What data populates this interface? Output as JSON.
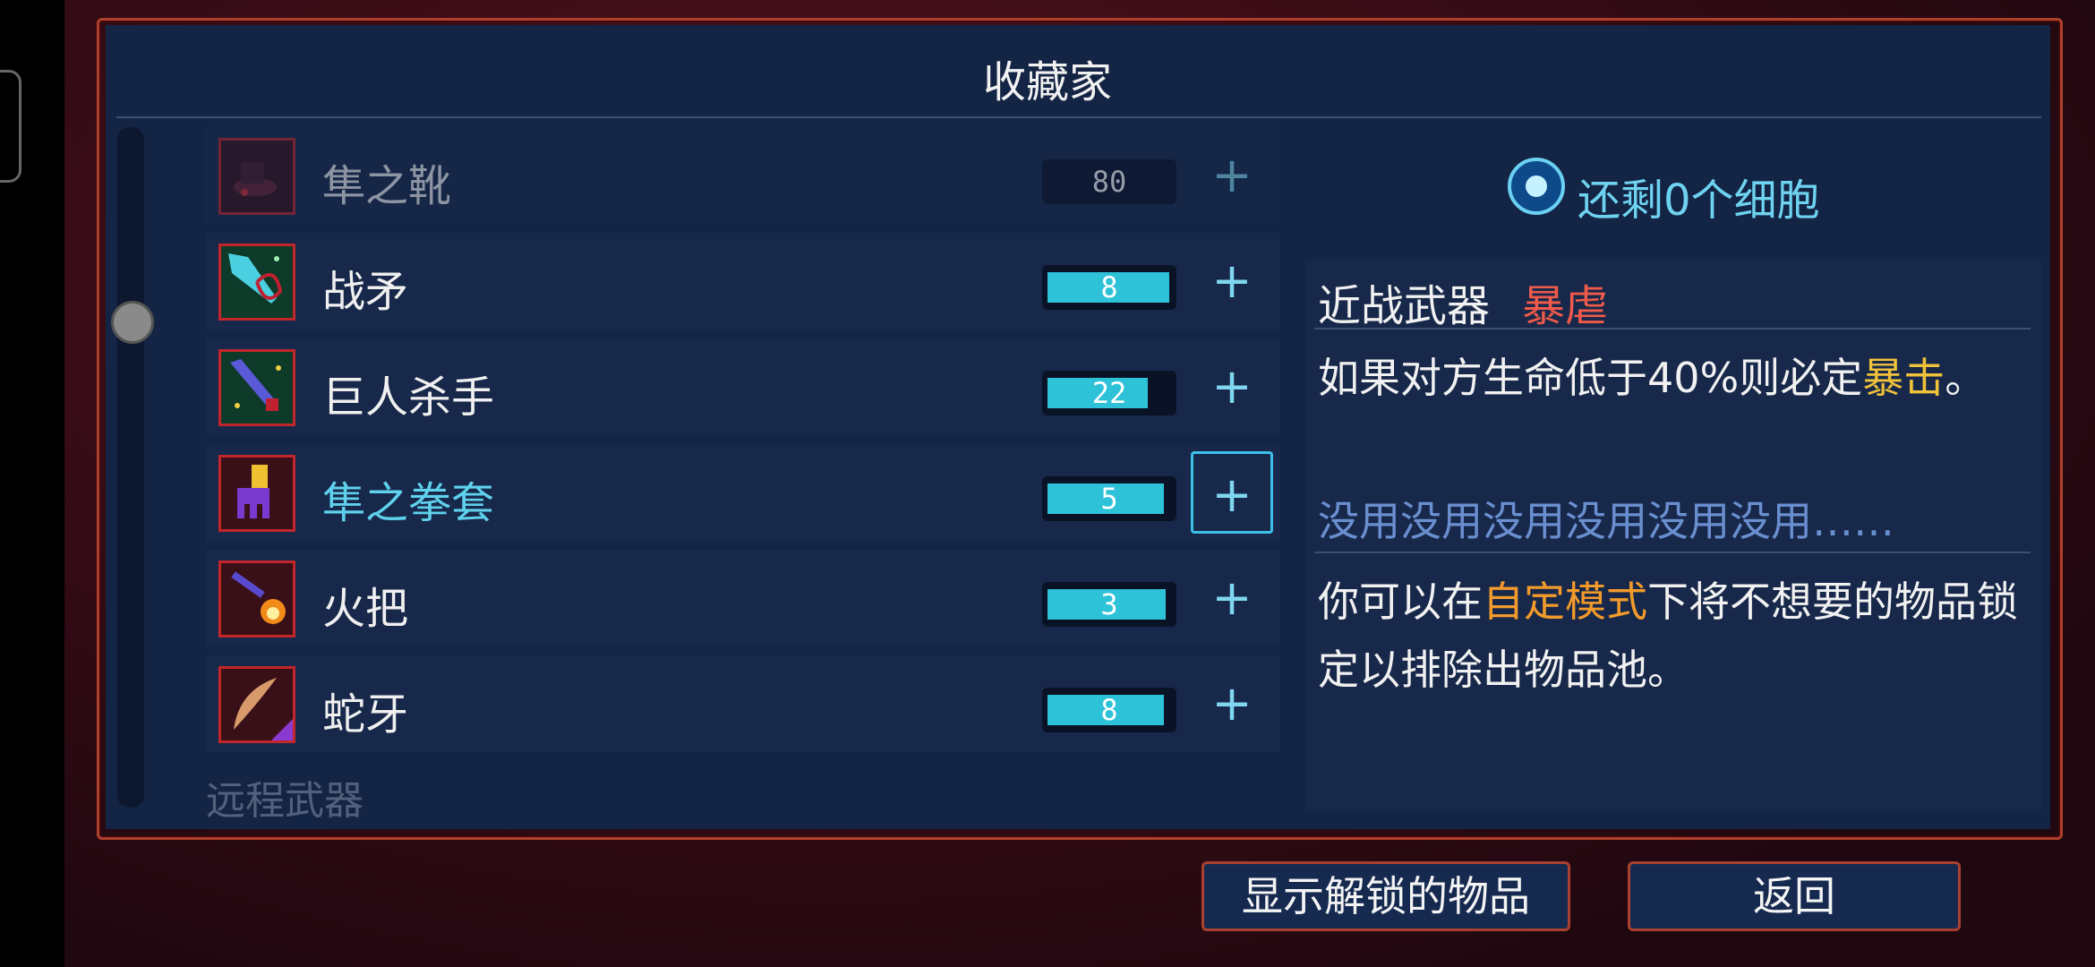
{
  "title": "收藏家",
  "cells": {
    "text": "还剩0个细胞"
  },
  "section_next": "远程武器",
  "items": [
    {
      "name": "隼之靴",
      "value": "80",
      "locked": true,
      "fill": 0,
      "selected": false,
      "icon": "hawk-boots-icon"
    },
    {
      "name": "战矛",
      "value": "8",
      "locked": false,
      "fill": 1,
      "selected": false,
      "icon": "war-spear-icon"
    },
    {
      "name": "巨人杀手",
      "value": "22",
      "locked": false,
      "fill": 1,
      "selected": false,
      "icon": "giant-killer-icon"
    },
    {
      "name": "隼之拳套",
      "value": "5",
      "locked": false,
      "fill": 1,
      "selected": true,
      "icon": "hawk-gauntlet-icon"
    },
    {
      "name": "火把",
      "value": "3",
      "locked": false,
      "fill": 1,
      "selected": false,
      "icon": "torch-icon"
    },
    {
      "name": "蛇牙",
      "value": "8",
      "locked": false,
      "fill": 1,
      "selected": false,
      "icon": "snake-fang-icon"
    }
  ],
  "plus_label": "+",
  "detail": {
    "category": "近战武器",
    "tag": "暴虐",
    "desc_before": "如果对方生命低于40%则必定",
    "desc_highlight": "暴击",
    "desc_after": "。",
    "flavor": "没用没用没用没用没用没用……",
    "hint_before": "你可以在",
    "hint_highlight": "自定模式",
    "hint_after": "下将不想要的物品锁定以排除出物品池。"
  },
  "buttons": {
    "show_unlocked": "显示解锁的物品",
    "back": "返回"
  },
  "colors": {
    "accent": "#5fd1ec",
    "tag_red": "#ef5a4a",
    "highlight_yellow": "#f0c23a",
    "highlight_orange": "#f29a2a",
    "frame": "#b0402a"
  }
}
